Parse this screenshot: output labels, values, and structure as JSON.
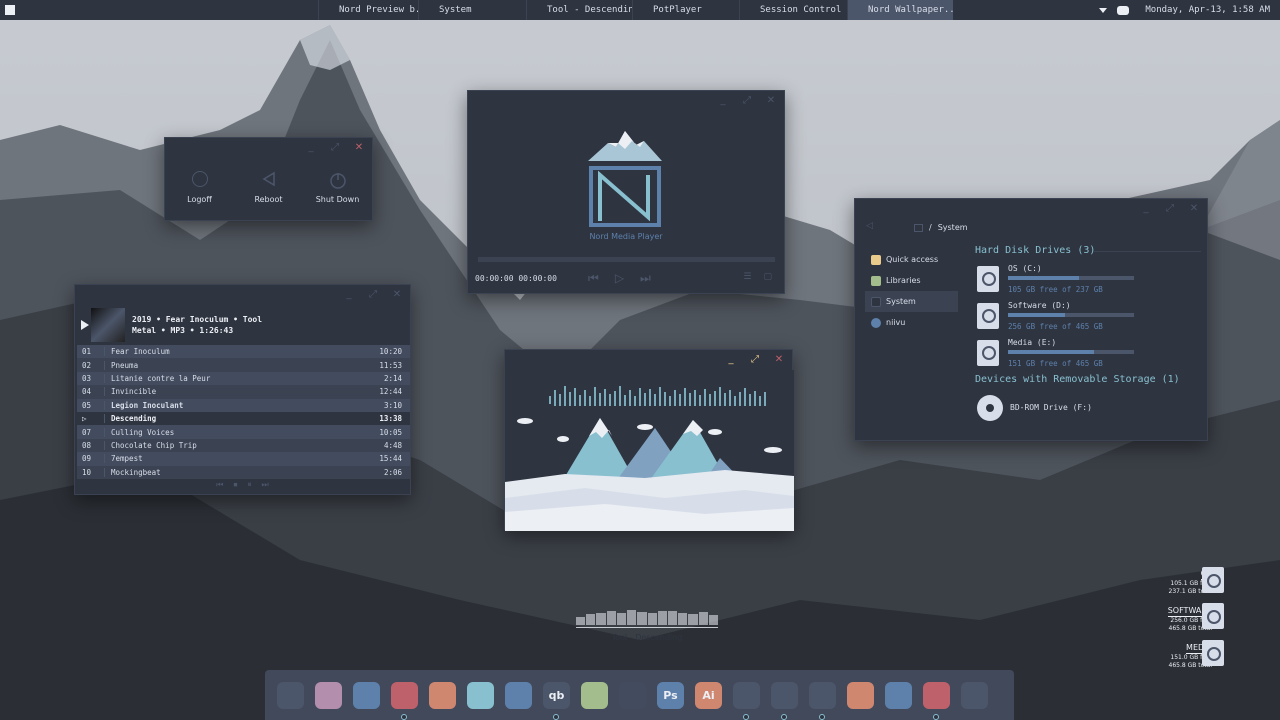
{
  "taskbar": {
    "tasks": [
      {
        "label": "Nord Preview b...",
        "active": false
      },
      {
        "label": "System",
        "active": false
      },
      {
        "label": "Tool - Descending",
        "active": false
      },
      {
        "label": "PotPlayer",
        "active": false
      },
      {
        "label": "Session Control",
        "active": false
      },
      {
        "label": "Nord Wallpaper...",
        "active": true
      }
    ],
    "clock": "Monday, Apr-13, 1:58 AM",
    "tray_icons": [
      "chevron-down-icon",
      "discord-icon"
    ]
  },
  "session_control": {
    "window_controls": [
      "_",
      "⤢",
      "✕"
    ],
    "items": [
      {
        "label": "Logoff",
        "icon": "logoff-icon"
      },
      {
        "label": "Reboot",
        "icon": "reboot-icon"
      },
      {
        "label": "Shut Down",
        "icon": "power-icon"
      }
    ]
  },
  "music": {
    "album_line1": "2019 • Fear Inoculum • Tool",
    "album_line2": "Metal • MP3 • 1:26:43",
    "controls": [
      "⏮",
      "⏹",
      "⏸",
      "⏭"
    ],
    "tracks": [
      {
        "num": "01",
        "title": "Fear Inoculum",
        "duration": "10:20"
      },
      {
        "num": "02",
        "title": "Pneuma",
        "duration": "11:53"
      },
      {
        "num": "03",
        "title": "Litanie contre la Peur",
        "duration": "2:14"
      },
      {
        "num": "04",
        "title": "Invincible",
        "duration": "12:44"
      },
      {
        "num": "05",
        "title": "Legion Inoculant",
        "duration": "3:10"
      },
      {
        "num": "▷",
        "title": "Descending",
        "duration": "13:38"
      },
      {
        "num": "07",
        "title": "Culling Voices",
        "duration": "10:05"
      },
      {
        "num": "08",
        "title": "Chocolate Chip Trip",
        "duration": "4:48"
      },
      {
        "num": "09",
        "title": "7empest",
        "duration": "15:44"
      },
      {
        "num": "10",
        "title": "Mockingbeat",
        "duration": "2:06"
      }
    ]
  },
  "media_player": {
    "logo_text": "Nord Media Player",
    "time_current": "00:00:00",
    "time_total": "00:00:00",
    "controls": [
      "⏮",
      "▷",
      "⏭"
    ],
    "extra": [
      "☰",
      "▢"
    ]
  },
  "explorer": {
    "path": "System",
    "sidebar": [
      {
        "label": "Quick access",
        "icon": "star-icon",
        "color": "#ebcb8b"
      },
      {
        "label": "Libraries",
        "icon": "libraries-icon",
        "color": "#a3be8c"
      },
      {
        "label": "System",
        "icon": "monitor-icon",
        "color": "#2e3440"
      },
      {
        "label": "niivu",
        "icon": "user-icon",
        "color": "#5e81ac"
      }
    ],
    "hard_disks_title": "Hard Disk Drives (3)",
    "drives": [
      {
        "name": "OS (C:)",
        "free": "105 GB free of 237 GB",
        "used_fraction": 0.56
      },
      {
        "name": "Software (D:)",
        "free": "256 GB free of 465 GB",
        "used_fraction": 0.45
      },
      {
        "name": "Media (E:)",
        "free": "151 GB free of 465 GB",
        "used_fraction": 0.68
      }
    ],
    "removable_title": "Devices with Removable Storage (1)",
    "removable": [
      {
        "name": "BD-ROM Drive (F:)"
      }
    ]
  },
  "visualizer": {
    "title": "Tool - Descending"
  },
  "desktop_drives": [
    {
      "title": "OS",
      "free": "105.1 GB free",
      "total": "237.1 GB total"
    },
    {
      "title": "SOFTWARE",
      "free": "256.0 GB free",
      "total": "465.8 GB total"
    },
    {
      "title": "MEDIA",
      "free": "151.0 GB free",
      "total": "465.8 GB total"
    }
  ],
  "dock": [
    {
      "name": "monitor-app",
      "glyph": "",
      "color": "#4c566a",
      "running": false
    },
    {
      "name": "user-app",
      "glyph": "",
      "color": "#b48ead",
      "running": false
    },
    {
      "name": "file-manager",
      "glyph": "",
      "color": "#5e81ac",
      "running": false
    },
    {
      "name": "chrome",
      "glyph": "",
      "color": "#bf616a",
      "running": true
    },
    {
      "name": "firefox",
      "glyph": "",
      "color": "#d08770",
      "running": false
    },
    {
      "name": "edge",
      "glyph": "",
      "color": "#88c0d0",
      "running": false
    },
    {
      "name": "discord",
      "glyph": "",
      "color": "#5e81ac",
      "running": false
    },
    {
      "name": "qbittorrent",
      "glyph": "qb",
      "color": "#4c566a",
      "running": true
    },
    {
      "name": "downloader",
      "glyph": "",
      "color": "#a3be8c",
      "running": false
    },
    {
      "name": "paint",
      "glyph": "",
      "color": "#434c5e",
      "running": false
    },
    {
      "name": "photoshop",
      "glyph": "Ps",
      "color": "#5e81ac",
      "running": false
    },
    {
      "name": "illustrator",
      "glyph": "Ai",
      "color": "#d08770",
      "running": false
    },
    {
      "name": "disk-app",
      "glyph": "",
      "color": "#4c566a",
      "running": true
    },
    {
      "name": "wolf-app",
      "glyph": "",
      "color": "#4c566a",
      "running": true
    },
    {
      "name": "video-player",
      "glyph": "",
      "color": "#4c566a",
      "running": true
    },
    {
      "name": "window-app",
      "glyph": "",
      "color": "#d08770",
      "running": false
    },
    {
      "name": "mixer-app",
      "glyph": "",
      "color": "#5e81ac",
      "running": false
    },
    {
      "name": "power-app",
      "glyph": "",
      "color": "#bf616a",
      "running": true
    },
    {
      "name": "trash",
      "glyph": "",
      "color": "#4c566a",
      "running": false
    }
  ]
}
